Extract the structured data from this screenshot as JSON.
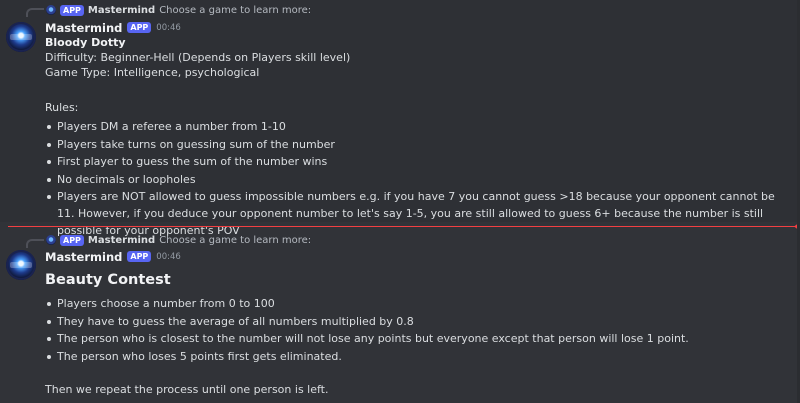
{
  "colors": {
    "background": "#313338",
    "accent": "#5865f2",
    "new_divider": "#f23f42",
    "text": "#dbdee1"
  },
  "message1": {
    "reply": {
      "badge": "APP",
      "name": "Mastermind",
      "text": "Choose a game to learn more:"
    },
    "author": "Mastermind",
    "badge": "APP",
    "time": "00:46",
    "title": "Bloody Dotty",
    "difficulty": "Difficulty: Beginner-Hell (Depends on Players skill level)",
    "game_type": "Game Type: Intelligence, psychological",
    "rules_label": "Rules:",
    "rules": [
      "Players DM a referee a number from 1-10",
      "Players take turns on guessing sum of the number",
      "First player to guess the sum of the number wins",
      "No decimals or loopholes",
      "Players are NOT allowed to guess impossible numbers e.g. if you have 7 you cannot guess >18 because your opponent cannot be 11. However, if you deduce your opponent number to let's say 1-5, you are still allowed to guess 6+ because the number is still possible for your opponent's POV"
    ]
  },
  "message2": {
    "reply": {
      "badge": "APP",
      "name": "Mastermind",
      "text": "Choose a game to learn more:"
    },
    "author": "Mastermind",
    "badge": "APP",
    "time": "00:46",
    "title": "Beauty Contest",
    "rules": [
      "Players choose a number from 0 to 100",
      "They have to guess the average of all numbers multiplied by 0.8",
      "The person who is closest to the number will not lose any points but everyone except that person will lose 1 point.",
      "The person who loses 5 points first gets eliminated."
    ],
    "footer": "Then we repeat the process until one person is left."
  },
  "icons": [
    "reaction-icon",
    "sticker-icon",
    "edit-icon",
    "more-icon"
  ]
}
